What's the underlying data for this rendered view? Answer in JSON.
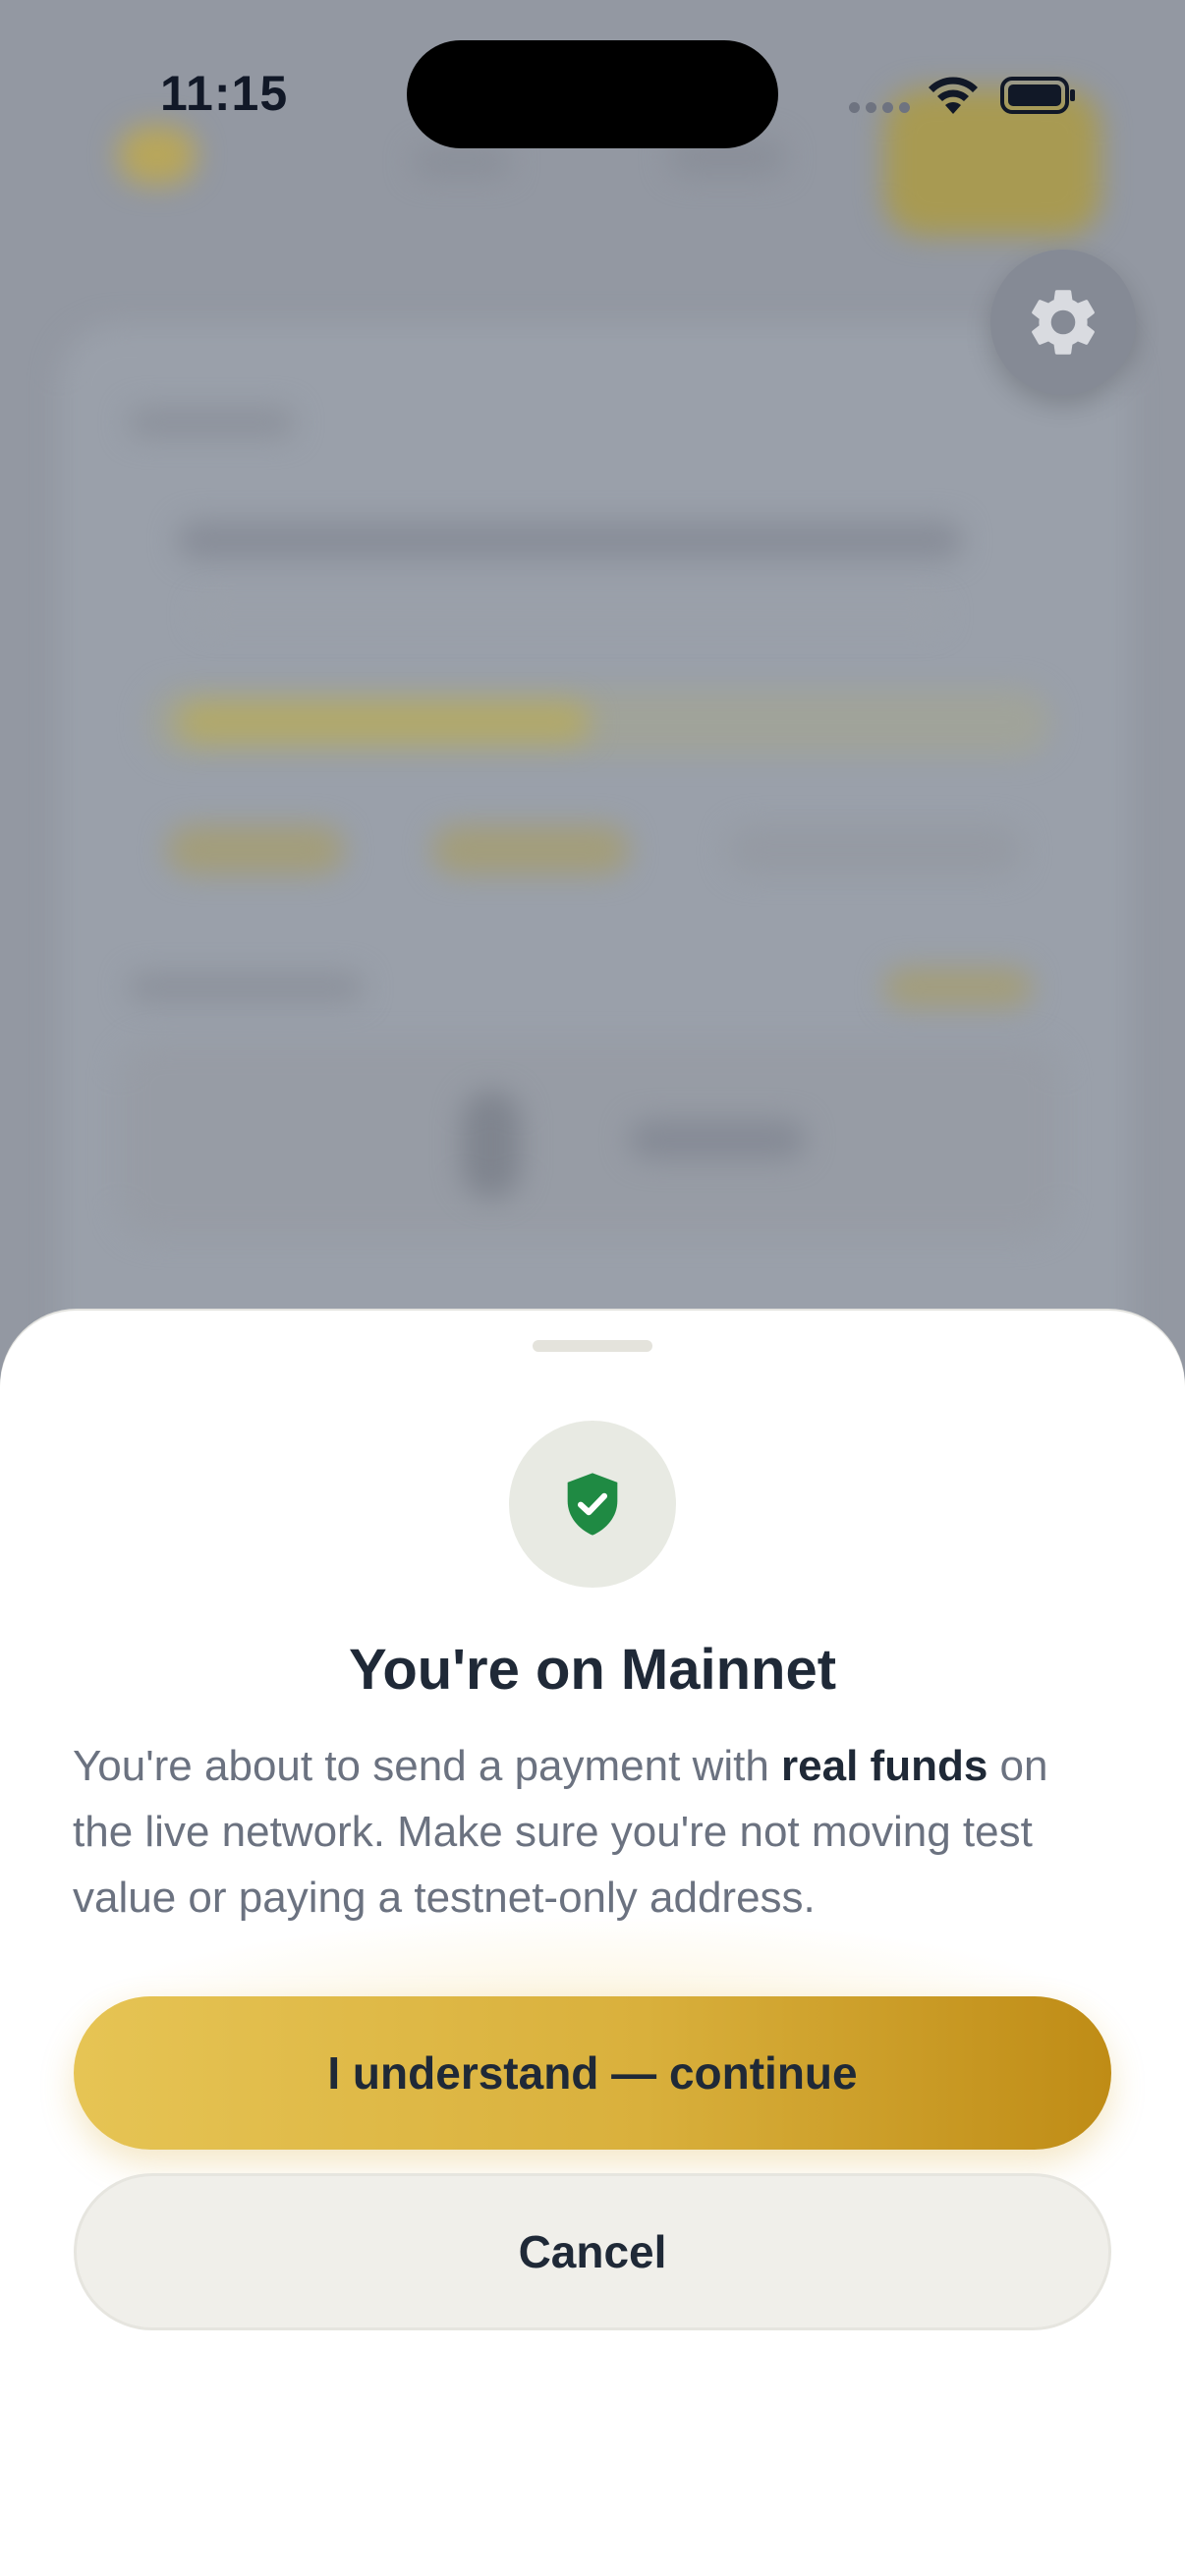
{
  "status_bar": {
    "time": "11:15",
    "icons": [
      "signal-dots-icon",
      "wifi-icon",
      "battery-icon"
    ]
  },
  "background": {
    "settings_icon": "gear-icon"
  },
  "sheet": {
    "icon": "shield-check-icon",
    "title": "You're on Mainnet",
    "body_before": "You're about to send a payment with ",
    "body_emphasis": "real funds",
    "body_after": " on the live network. Make sure you're not moving test value or paying a testnet-only address.",
    "primary_button_label": "I understand — continue",
    "secondary_button_label": "Cancel"
  },
  "colors": {
    "accent_gold": "#d9b03c",
    "shield_green": "#1f8a43",
    "text_dark": "#1f2937",
    "text_muted": "#6b7280"
  }
}
